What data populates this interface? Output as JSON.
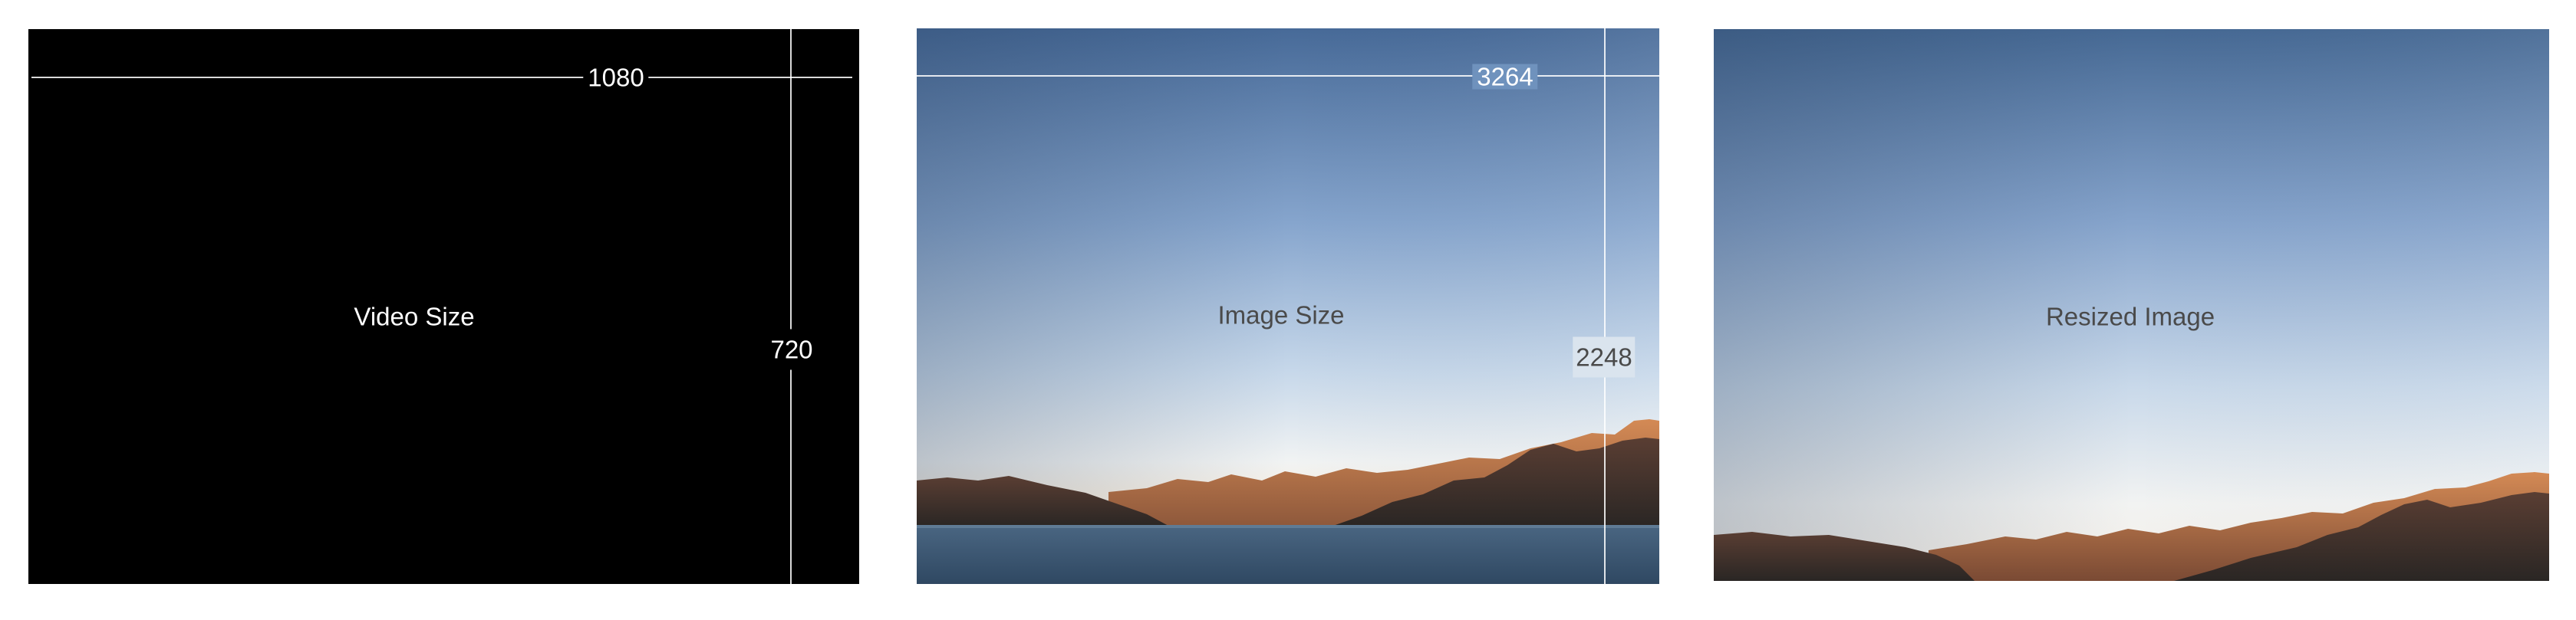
{
  "panels": {
    "video": {
      "title": "Video Size",
      "width_label": "1080",
      "height_label": "720",
      "background": "#000000"
    },
    "image": {
      "title": "Image Size",
      "width_label": "3264",
      "height_label": "2248"
    },
    "resized": {
      "title": "Resized Image"
    }
  },
  "colors": {
    "sky_top": "#4a6d99",
    "sky_mid": "#9fbadb",
    "sky_horizon": "#f3f5f6",
    "mountain_dark": "#3a302c",
    "mountain_lit": "#b86a3e",
    "lake": "#3a5570",
    "label_dark": "#4a4a4a",
    "label_light": "#ffffff"
  }
}
